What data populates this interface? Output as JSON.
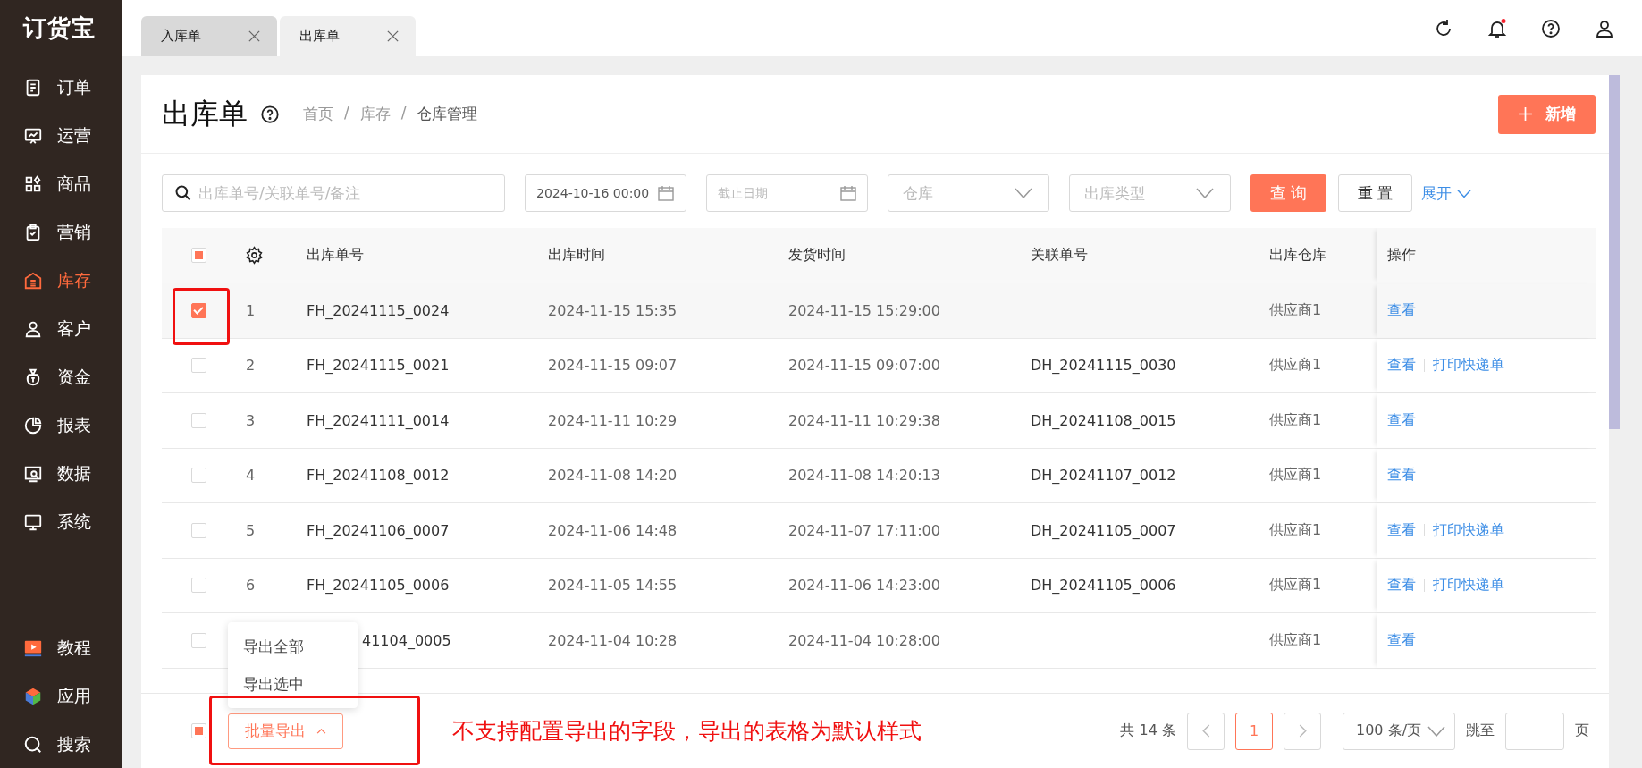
{
  "app": {
    "logo": "订货宝"
  },
  "sidebar": {
    "items": [
      {
        "label": "订单",
        "selected": false
      },
      {
        "label": "运营",
        "selected": false
      },
      {
        "label": "商品",
        "selected": false
      },
      {
        "label": "营销",
        "selected": false
      },
      {
        "label": "库存",
        "selected": true
      },
      {
        "label": "客户",
        "selected": false
      },
      {
        "label": "资金",
        "selected": false
      },
      {
        "label": "报表",
        "selected": false
      },
      {
        "label": "数据",
        "selected": false
      },
      {
        "label": "系统",
        "selected": false
      }
    ],
    "bottom_items": [
      {
        "label": "教程"
      },
      {
        "label": "应用"
      },
      {
        "label": "搜索"
      }
    ]
  },
  "tabs": [
    {
      "label": "入库单",
      "selected": false
    },
    {
      "label": "出库单",
      "selected": true
    }
  ],
  "page": {
    "title": "出库单",
    "breadcrumb": [
      {
        "kind": "link",
        "text": "首页"
      },
      {
        "kind": "separator",
        "text": "/"
      },
      {
        "kind": "link",
        "text": "库存"
      },
      {
        "kind": "separator",
        "text": "/"
      },
      {
        "kind": "current",
        "text": "仓库管理"
      }
    ],
    "new_button": "新增"
  },
  "filters": {
    "search": {
      "placeholder": "出库单号/关联单号/备注"
    },
    "start_date": {
      "value": "2024-10-16 00:00"
    },
    "end_date": {
      "placeholder": "截止日期"
    },
    "warehouse": {
      "placeholder": "仓库"
    },
    "type": {
      "placeholder": "出库类型"
    },
    "query_button": "查 询",
    "reset_button": "重 置",
    "expand_link": "展开"
  },
  "table": {
    "indeterminate": true,
    "columns": [
      "出库单号",
      "出库时间",
      "发货时间",
      "关联单号",
      "出库仓库",
      "操作"
    ],
    "rows": [
      {
        "index": "1",
        "selected": true,
        "number": "FH_20241115_0024",
        "out_time": "2024-11-15 15:35",
        "ship_time": "2024-11-15 15:29:00",
        "warehouse": "供应商1",
        "actions": [
          "查看"
        ]
      },
      {
        "index": "2",
        "selected": false,
        "number": "FH_20241115_0021",
        "out_time": "2024-11-15 09:07",
        "ship_time": "2024-11-15 09:07:00",
        "linked": "DH_20241115_0030",
        "warehouse": "供应商1",
        "actions": [
          "查看",
          "打印快递单"
        ]
      },
      {
        "index": "3",
        "selected": false,
        "number": "FH_20241111_0014",
        "out_time": "2024-11-11 10:29",
        "ship_time": "2024-11-11 10:29:38",
        "linked": "DH_20241108_0015",
        "warehouse": "供应商1",
        "actions": [
          "查看"
        ]
      },
      {
        "index": "4",
        "selected": false,
        "number": "FH_20241108_0012",
        "out_time": "2024-11-08 14:20",
        "ship_time": "2024-11-08 14:20:13",
        "linked": "DH_20241107_0012",
        "warehouse": "供应商1",
        "actions": [
          "查看"
        ]
      },
      {
        "index": "5",
        "selected": false,
        "number": "FH_20241106_0007",
        "out_time": "2024-11-06 14:48",
        "ship_time": "2024-11-07 17:11:00",
        "linked": "DH_20241105_0007",
        "warehouse": "供应商1",
        "actions": [
          "查看",
          "打印快递单"
        ]
      },
      {
        "index": "6",
        "selected": false,
        "number": "FH_20241105_0006",
        "out_time": "2024-11-05 14:55",
        "ship_time": "2024-11-06 14:23:00",
        "linked": "DH_20241105_0006",
        "warehouse": "供应商1",
        "actions": [
          "查看",
          "打印快递单"
        ]
      },
      {
        "selected": false,
        "number": "41104_0005",
        "partly_hidden": true,
        "out_time": "2024-11-04 10:28",
        "ship_time": "2024-11-04 10:28:00",
        "warehouse": "供应商1",
        "actions": [
          "查看"
        ]
      }
    ]
  },
  "footer": {
    "indeterminate": true,
    "bulk_export": {
      "label": "批量导出",
      "expanded": true
    },
    "export_menu": [
      "导出全部",
      "导出选中"
    ],
    "pagination": {
      "total": "共 14 条",
      "pages": [
        {
          "label": "1",
          "selected": true
        }
      ],
      "page_size": "100 条/页",
      "jump_label": "跳至",
      "page_suffix": "页"
    }
  },
  "annotation": {
    "note": "不支持配置导出的字段，导出的表格为默认样式"
  }
}
